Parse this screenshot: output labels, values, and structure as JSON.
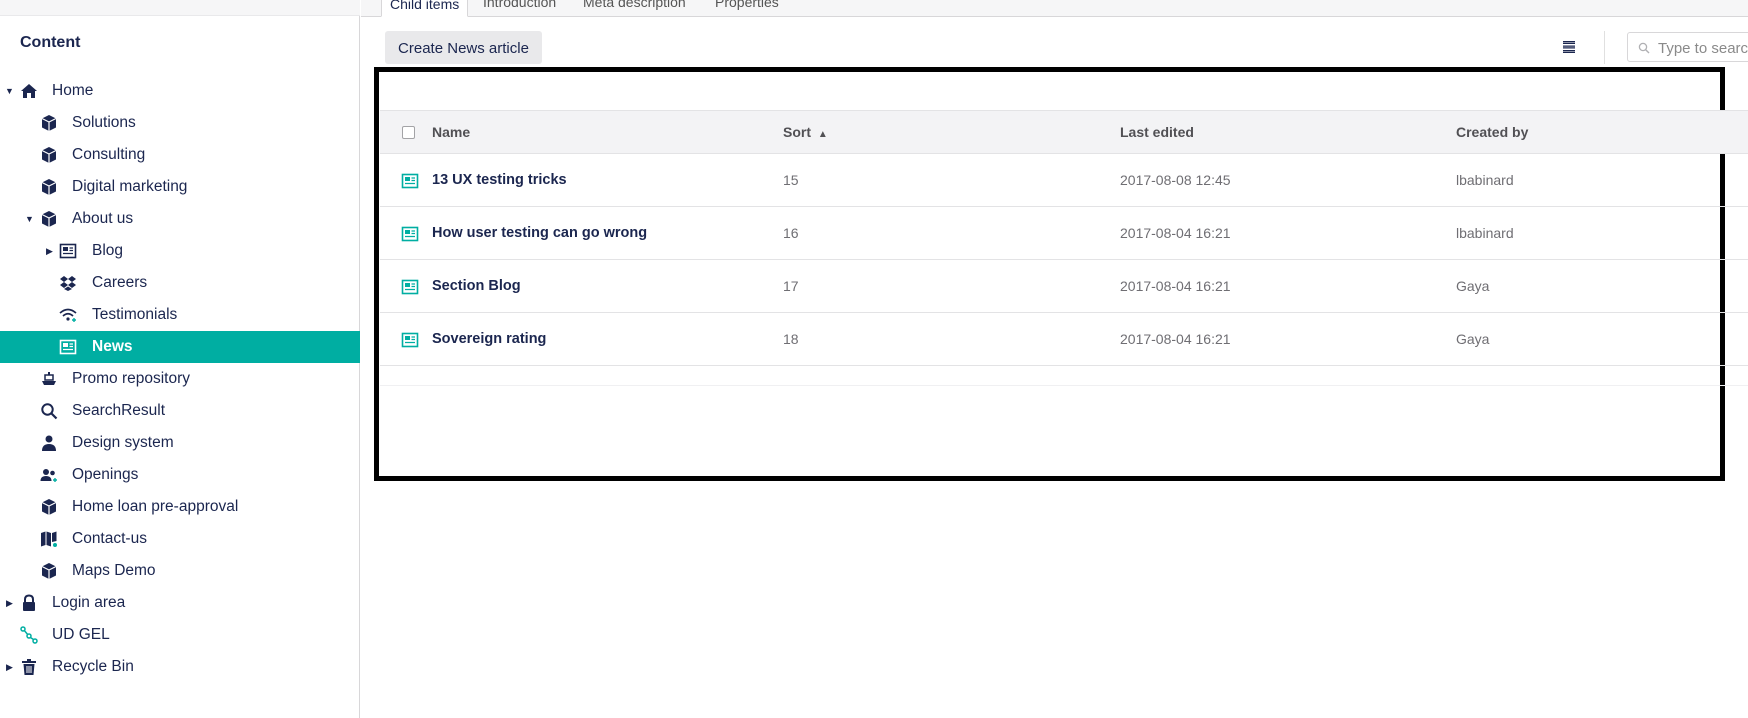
{
  "sidebar": {
    "section_title": "Content",
    "items": [
      {
        "label": "Home",
        "icon": "home-icon"
      },
      {
        "label": "Solutions",
        "icon": "cube-icon"
      },
      {
        "label": "Consulting",
        "icon": "cube-icon"
      },
      {
        "label": "Digital marketing",
        "icon": "cube-icon"
      },
      {
        "label": "About us",
        "icon": "cube-icon"
      },
      {
        "label": "Blog",
        "icon": "newspaper-icon"
      },
      {
        "label": "Careers",
        "icon": "dropbox-icon"
      },
      {
        "label": "Testimonials",
        "icon": "wifi-icon"
      },
      {
        "label": "News",
        "icon": "newspaper-icon"
      },
      {
        "label": "Promo repository",
        "icon": "ship-icon"
      },
      {
        "label": "SearchResult",
        "icon": "search-icon"
      },
      {
        "label": "Design system",
        "icon": "user-icon"
      },
      {
        "label": "Openings",
        "icon": "users-icon"
      },
      {
        "label": "Home loan pre-approval",
        "icon": "cube-icon"
      },
      {
        "label": "Contact-us",
        "icon": "map-icon"
      },
      {
        "label": "Maps Demo",
        "icon": "cube-icon"
      },
      {
        "label": "Login area",
        "icon": "lock-icon"
      },
      {
        "label": "UD GEL",
        "icon": "network-icon"
      },
      {
        "label": "Recycle Bin",
        "icon": "trash-icon"
      }
    ]
  },
  "tabs": [
    "Child items",
    "Introduction",
    "Meta description",
    "Properties"
  ],
  "toolbar": {
    "create_label": "Create News article",
    "search_placeholder": "Type to search"
  },
  "table": {
    "headers": {
      "name": "Name",
      "sort": "Sort",
      "last_edited": "Last edited",
      "created_by": "Created by"
    },
    "rows": [
      {
        "name": "13 UX testing tricks",
        "sort": "15",
        "last_edited": "2017-08-08 12:45",
        "created_by": "lbabinard"
      },
      {
        "name": "How user testing can go wrong",
        "sort": "16",
        "last_edited": "2017-08-04 16:21",
        "created_by": "lbabinard"
      },
      {
        "name": "Section Blog",
        "sort": "17",
        "last_edited": "2017-08-04 16:21",
        "created_by": "Gaya"
      },
      {
        "name": "Sovereign rating",
        "sort": "18",
        "last_edited": "2017-08-04 16:21",
        "created_by": "Gaya"
      }
    ]
  },
  "colors": {
    "accent": "#00aea2",
    "text": "#1b264f",
    "highlight_frame": "#000000"
  }
}
